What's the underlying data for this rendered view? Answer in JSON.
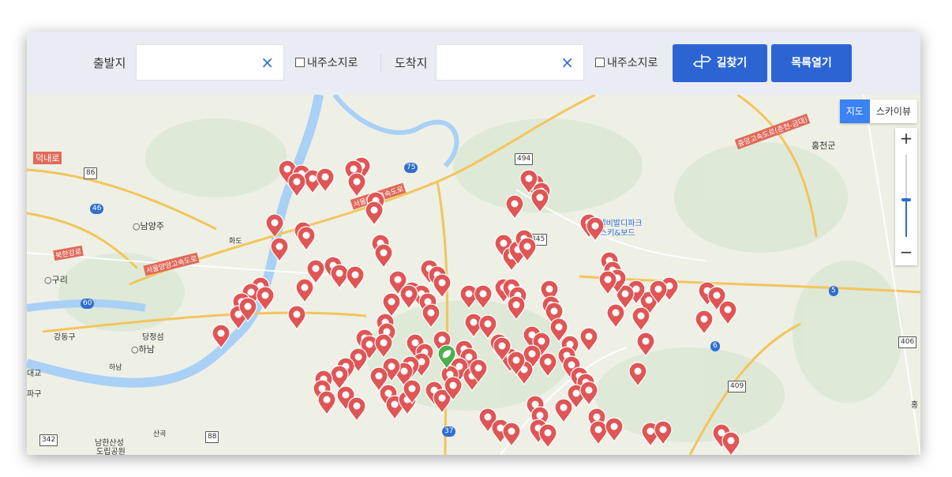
{
  "toolbar": {
    "origin_label": "출발지",
    "origin_value": "",
    "origin_clear": "×",
    "origin_myaddr": "내주소지로",
    "dest_label": "도착지",
    "dest_value": "",
    "dest_clear": "×",
    "dest_myaddr": "내주소지로",
    "route_button": "길찾기",
    "list_button": "목록열기"
  },
  "map": {
    "type_map": "지도",
    "type_sky": "스카이뷰",
    "zoom_in": "+",
    "zoom_out": "−",
    "zoom_level_fraction": 0.45,
    "labels": [
      "덕내로",
      "화도",
      "○남양주",
      "북한강로",
      "○구리",
      "서울양양고속도로",
      "서울양양고속도로",
      "홍천군",
      "소노벨비발디파크",
      "스키&보드",
      "강동구",
      "당정섬",
      "○하남",
      "하남",
      "대교",
      "파구",
      "남한산성",
      "도립공원",
      "산곡",
      "중앙고속도로(춘천-금대)",
      "홍"
    ],
    "route_numbers": [
      "86",
      "46",
      "75",
      "494",
      "345",
      "60",
      "5",
      "6",
      "406",
      "409",
      "37",
      "342",
      "88"
    ],
    "pin_color": "#e05555",
    "green_pin_color": "#4caf50"
  }
}
